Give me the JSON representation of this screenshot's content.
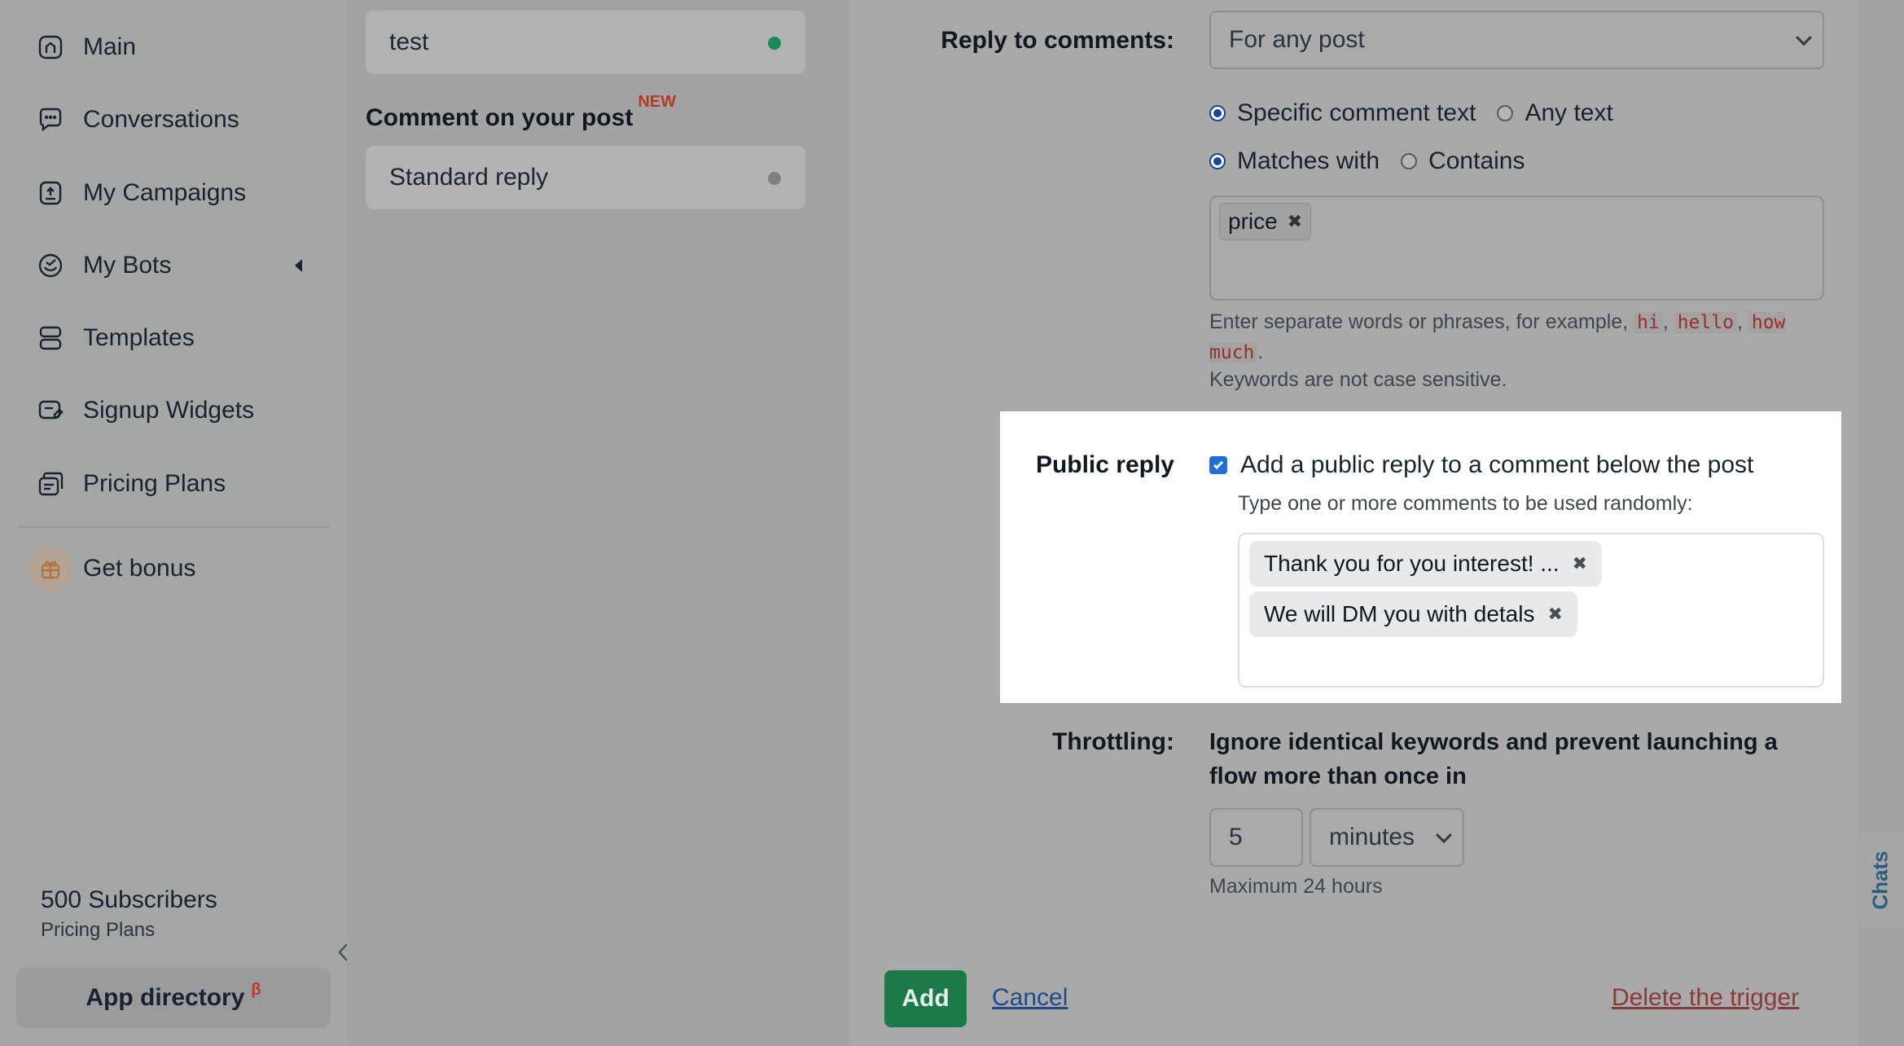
{
  "sidebar": {
    "items": [
      {
        "label": "Main",
        "icon": "home-icon"
      },
      {
        "label": "Conversations",
        "icon": "chat-icon"
      },
      {
        "label": "My Campaigns",
        "icon": "campaign-icon"
      },
      {
        "label": "My Bots",
        "icon": "bot-icon"
      },
      {
        "label": "Templates",
        "icon": "templates-icon"
      },
      {
        "label": "Signup Widgets",
        "icon": "widget-icon"
      },
      {
        "label": "Pricing Plans",
        "icon": "pricing-icon"
      }
    ],
    "bonus_label": "Get bonus",
    "subscribers": "500 Subscribers",
    "plan_link": "Pricing Plans",
    "app_directory": "App directory",
    "app_directory_badge": "β"
  },
  "middle": {
    "card_test": "test",
    "section_title": "Comment on your post",
    "section_badge": "NEW",
    "card_standard": "Standard reply",
    "colors": {
      "active_dot": "#1a8a5a",
      "inactive_dot": "#7f8080"
    }
  },
  "form": {
    "reply_label": "Reply to comments:",
    "reply_value": "For any post",
    "radio_specific": "Specific comment text",
    "radio_any": "Any text",
    "radio_matches": "Matches with",
    "radio_contains": "Contains",
    "keyword_tag": "price",
    "help_prefix": "Enter separate words or phrases, for example,",
    "help_code1": "hi",
    "help_code2": "hello",
    "help_code3": "how much",
    "help_case": "Keywords are not case sensitive.",
    "public_label": "Public reply",
    "public_check_label": "Add a public reply to a comment below the post",
    "public_hint": "Type one or more comments to be used randomly:",
    "public_tags": [
      "Thank you for you interest! ...",
      "We will DM you with detals"
    ],
    "throttling_label": "Throttling:",
    "throttling_text": "Ignore identical keywords and prevent launching a flow more than once in",
    "throttle_value": "5",
    "throttle_unit": "minutes",
    "throttle_max": "Maximum 24 hours",
    "add_button": "Add",
    "cancel_link": "Cancel",
    "delete_link": "Delete the trigger"
  },
  "chats_tab": "Chats"
}
